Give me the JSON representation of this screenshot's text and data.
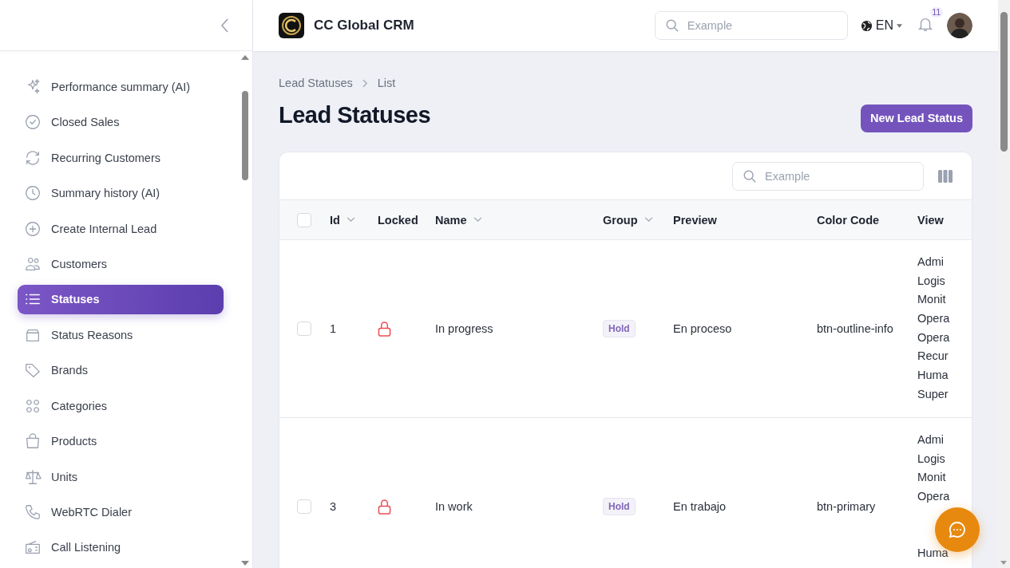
{
  "sidebar": {
    "items": [
      {
        "label": "Performance summary (AI)",
        "selected": false
      },
      {
        "label": "Closed Sales",
        "selected": false
      },
      {
        "label": "Recurring Customers",
        "selected": false
      },
      {
        "label": "Summary history (AI)",
        "selected": false
      },
      {
        "label": "Create Internal Lead",
        "selected": false
      },
      {
        "label": "Customers",
        "selected": false
      },
      {
        "label": "Statuses",
        "selected": true
      },
      {
        "label": "Status Reasons",
        "selected": false
      },
      {
        "label": "Brands",
        "selected": false
      },
      {
        "label": "Categories",
        "selected": false
      },
      {
        "label": "Products",
        "selected": false
      },
      {
        "label": "Units",
        "selected": false
      },
      {
        "label": "WebRTC Dialer",
        "selected": false
      },
      {
        "label": "Call Listening",
        "selected": false
      }
    ]
  },
  "topbar": {
    "app_name": "CC Global CRM",
    "search": {
      "placeholder": "Example"
    },
    "language": "EN",
    "notifications": "11"
  },
  "breadcrumb": [
    "Lead Statuses",
    "List"
  ],
  "title": "Lead Statuses",
  "new_button": "New Lead Status",
  "table": {
    "search": {
      "placeholder": "Example"
    },
    "select_all": {
      "checked": false
    },
    "columns": [
      {
        "label": "Id",
        "sortable": true
      },
      {
        "label": "Locked",
        "sortable": false
      },
      {
        "label": "Name",
        "sortable": true
      },
      {
        "label": "Group",
        "sortable": true
      },
      {
        "label": "Preview",
        "sortable": false
      },
      {
        "label": "Color Code",
        "sortable": false
      },
      {
        "label": "View",
        "sortable": false
      }
    ],
    "rows": [
      {
        "checked": false,
        "id": "1",
        "locked": true,
        "name": "In progress",
        "group": "Hold",
        "preview": "En proceso",
        "color_code": "btn-outline-info",
        "view": [
          "Admi",
          "Logis",
          "Monit",
          "Opera",
          "Opera",
          "Recur",
          "Huma",
          "Super"
        ]
      },
      {
        "checked": false,
        "id": "3",
        "locked": true,
        "name": "In work",
        "group": "Hold",
        "preview": "En trabajo",
        "color_code": "btn-primary",
        "view": [
          "Admi",
          "Logis",
          "Monit",
          "Opera"
        ],
        "view_below_button": [
          "Huma"
        ]
      }
    ]
  }
}
